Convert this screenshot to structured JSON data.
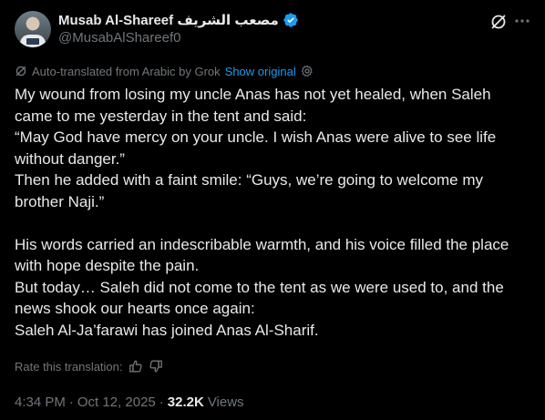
{
  "author": {
    "display_name": "Musab Al-Shareef مصعب الشريف",
    "handle": "@MusabAlShareef0",
    "verified": true,
    "verified_color": "#1d9bf0"
  },
  "translation": {
    "notice": "Auto-translated from Arabic by Grok",
    "show_original": "Show original",
    "rate_label": "Rate this translation:"
  },
  "tweet": {
    "paragraphs": [
      "My wound from losing my uncle Anas has not yet healed, when Saleh came to me yesterday in the tent and said:",
      "“May God have mercy on your uncle. I wish Anas were alive to see life without danger.”",
      "Then he added with a faint smile: “Guys, we’re going to welcome my brother Naji.”",
      "",
      "His words carried an indescribable warmth, and his voice filled the place with hope despite the pain.",
      "But today… Saleh did not come to the tent as we were used to, and the news shook our hearts once again:",
      "Saleh Al-Ja’farawi has joined Anas Al-Sharif."
    ]
  },
  "meta": {
    "time": "4:34 PM",
    "separator": "·",
    "date": "Oct 12, 2025",
    "views_count": "32.2K",
    "views_label": "Views"
  },
  "colors": {
    "background": "#000000",
    "text": "#e7e9ea",
    "secondary": "#71767b",
    "link": "#1d9bf0"
  },
  "icons": {
    "grok": "grok-icon",
    "more": "more-icon",
    "settings": "gear-icon",
    "thumbs_up": "thumbs-up-icon",
    "thumbs_down": "thumbs-down-icon"
  }
}
